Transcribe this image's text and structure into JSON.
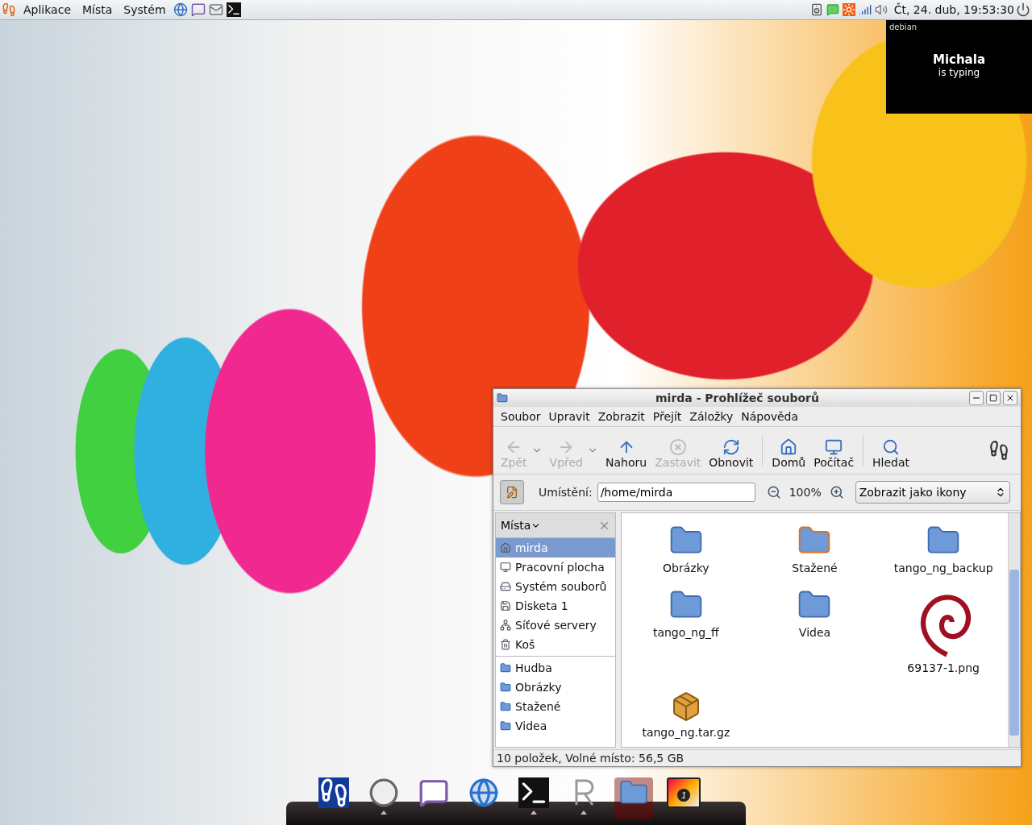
{
  "top_panel": {
    "menus": [
      {
        "label": "Aplikace"
      },
      {
        "label": "Místa"
      },
      {
        "label": "Systém"
      }
    ],
    "clock": "Čt, 24. dub, 19:53:30"
  },
  "notification": {
    "brand": "debian",
    "name": "Michala",
    "status": "is typing"
  },
  "window": {
    "title": "mirda - Prohlížeč souborů",
    "menu": [
      "Soubor",
      "Upravit",
      "Zobrazit",
      "Přejít",
      "Záložky",
      "Nápověda"
    ],
    "toolbar": [
      [
        {
          "kind": "back",
          "label": "Zpět",
          "disabled": true,
          "dropdown": true
        },
        {
          "kind": "forward",
          "label": "Vpřed",
          "disabled": true,
          "dropdown": true
        },
        {
          "kind": "up",
          "label": "Nahoru",
          "disabled": false,
          "dropdown": false
        },
        {
          "kind": "stop",
          "label": "Zastavit",
          "disabled": true,
          "dropdown": false
        },
        {
          "kind": "reload",
          "label": "Obnovit",
          "disabled": false,
          "dropdown": false
        }
      ],
      [
        {
          "kind": "home",
          "label": "Domů",
          "disabled": false,
          "dropdown": false
        },
        {
          "kind": "computer",
          "label": "Počítač",
          "disabled": false,
          "dropdown": false
        }
      ],
      [
        {
          "kind": "search",
          "label": "Hledat",
          "disabled": false,
          "dropdown": false
        }
      ]
    ],
    "location": {
      "label": "Umístění:",
      "value": "/home/mirda",
      "zoom": "100%",
      "view": "Zobrazit jako ikony"
    },
    "sidebar": {
      "title": "Místa",
      "groups": [
        [
          {
            "kind": "home",
            "label": "mirda",
            "selected": true
          },
          {
            "kind": "desktop",
            "label": "Pracovní plocha",
            "selected": false
          },
          {
            "kind": "drive",
            "label": "Systém souborů",
            "selected": false
          },
          {
            "kind": "floppy",
            "label": "Disketa 1",
            "selected": false
          },
          {
            "kind": "network",
            "label": "Síťové servery",
            "selected": false
          },
          {
            "kind": "trash",
            "label": "Koš",
            "selected": false
          }
        ],
        [
          {
            "kind": "folder",
            "label": "Hudba",
            "selected": false
          },
          {
            "kind": "folder",
            "label": "Obrázky",
            "selected": false
          },
          {
            "kind": "folder",
            "label": "Stažené",
            "selected": false
          },
          {
            "kind": "folder",
            "label": "Videa",
            "selected": false
          }
        ]
      ]
    },
    "files": [
      {
        "kind": "folder",
        "name": "Obrázky"
      },
      {
        "kind": "download-folder",
        "name": "Stažené"
      },
      {
        "kind": "folder",
        "name": "tango_ng_backup"
      },
      {
        "kind": "folder",
        "name": "tango_ng_ff"
      },
      {
        "kind": "folder",
        "name": "Videa"
      },
      {
        "kind": "image",
        "name": "69137-1.png"
      },
      {
        "kind": "archive",
        "name": "tango_ng.tar.gz"
      }
    ],
    "status_bar": "10 položek, Volné místo: 56,5 GB"
  },
  "dock": {
    "items": [
      {
        "kind": "foot",
        "running": false,
        "selected": false
      },
      {
        "kind": "mail-clock",
        "running": true,
        "selected": false
      },
      {
        "kind": "chat",
        "running": false,
        "selected": false
      },
      {
        "kind": "globe",
        "running": false,
        "selected": false
      },
      {
        "kind": "terminal",
        "running": true,
        "selected": false
      },
      {
        "kind": "letter-r",
        "running": true,
        "selected": false
      },
      {
        "kind": "folder",
        "running": false,
        "selected": true
      },
      {
        "kind": "photo",
        "running": false,
        "selected": false,
        "badge": "1"
      }
    ]
  }
}
